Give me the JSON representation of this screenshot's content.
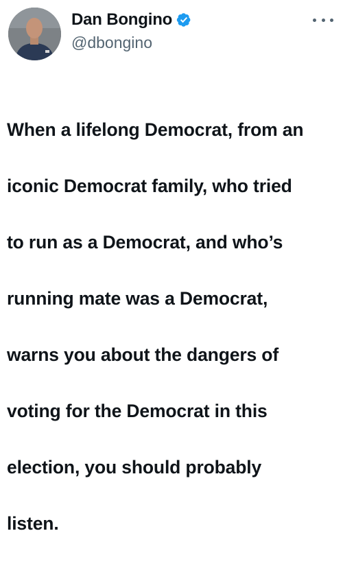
{
  "author": {
    "display_name": "Dan Bongino",
    "handle": "@dbongino",
    "verified": true,
    "avatar_icon": "profile-photo"
  },
  "post": {
    "text_lines": [
      "When a lifelong Democrat, from an",
      "iconic Democrat family, who tried",
      "to run as a Democrat, and who’s",
      "running mate was a Democrat,",
      "warns you about the dangers of",
      "voting for the Democrat in this",
      "election, you should probably",
      "listen."
    ]
  },
  "icons": {
    "verified": "verified-badge-icon",
    "more": "more-options-icon"
  },
  "colors": {
    "text": "#0f1419",
    "secondary": "#536471",
    "verified_blue": "#1d9bf0",
    "background": "#ffffff"
  }
}
